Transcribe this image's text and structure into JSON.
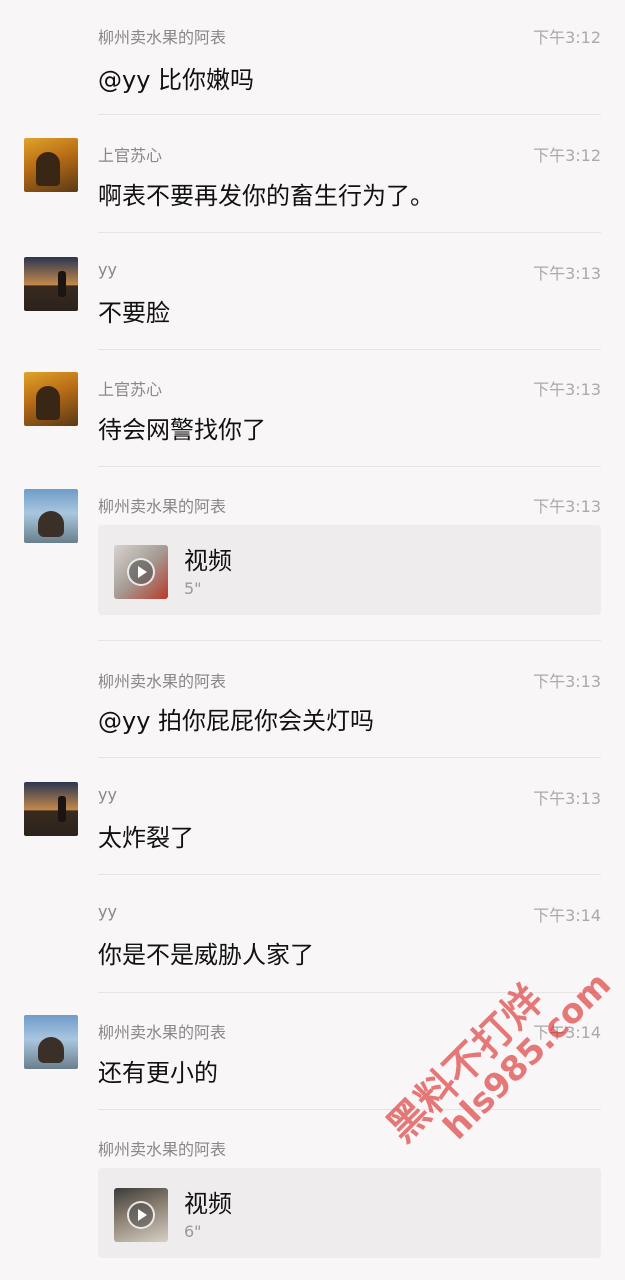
{
  "messages": [
    {
      "name": "柳州卖水果的阿表",
      "time": "下午3:12",
      "text": "@yy 比你嫩吗",
      "avatar": "none"
    },
    {
      "name": "上官苏心",
      "time": "下午3:12",
      "text": "啊表不要再发你的畜生行为了。",
      "avatar": "woman-avatar-icon"
    },
    {
      "name": "yy",
      "time": "下午3:13",
      "text": "不要脸",
      "avatar": "sunset-avatar-icon"
    },
    {
      "name": "上官苏心",
      "time": "下午3:13",
      "text": "待会网警找你了",
      "avatar": "woman-avatar-icon"
    },
    {
      "name": "柳州卖水果的阿表",
      "time": "下午3:13",
      "video_label": "视频",
      "video_duration": "5\"",
      "avatar": "man-avatar-icon"
    },
    {
      "name": "柳州卖水果的阿表",
      "time": "下午3:13",
      "text": "@yy 拍你屁屁你会关灯吗",
      "avatar": "none"
    },
    {
      "name": "yy",
      "time": "下午3:13",
      "text": "太炸裂了",
      "avatar": "sunset-avatar-icon"
    },
    {
      "name": "yy",
      "time": "下午3:14",
      "text": "你是不是威胁人家了",
      "avatar": "none"
    },
    {
      "name": "柳州卖水果的阿表",
      "time": "下午3:14",
      "text": "还有更小的",
      "avatar": "man-avatar-icon"
    },
    {
      "name": "柳州卖水果的阿表",
      "time": "",
      "video_label": "视频",
      "video_duration": "6\"",
      "avatar": "none"
    }
  ],
  "watermark": {
    "line1": "黑料不打烊",
    "line2": "hls985.com"
  }
}
